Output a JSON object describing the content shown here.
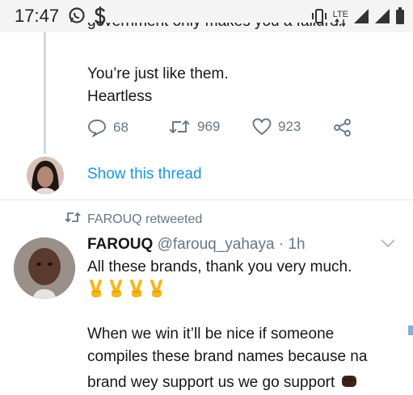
{
  "status_bar": {
    "time": "17:47",
    "left_icons": [
      "whatsapp-icon",
      "dollar-icon"
    ],
    "right_icons": [
      "vibrate-icon",
      "lte-icon",
      "signal-icon",
      "signal-icon",
      "battery-icon"
    ],
    "lte_label": "LTE"
  },
  "tweet1": {
    "clipped_text": "government only makes you a failure.",
    "line1": "You’re just like them.",
    "line2": "Heartless",
    "replies": "68",
    "retweets": "969",
    "likes": "923"
  },
  "show_thread": "Show this thread",
  "retweet_context": "FAROUQ retweeted",
  "tweet2": {
    "name": "FAROUQ",
    "handle": "@farouq_yahaya",
    "sep": "·",
    "time": "1h",
    "line1": "All these brands, thank you very much.",
    "emoji_count": 4,
    "line2": "When we win it’ll be nice if someone",
    "line3": "compiles these brand names because na",
    "line4": "brand wey support us we go support"
  },
  "colors": {
    "accent": "#1b95e0",
    "muted": "#657786",
    "text": "#14171a",
    "status_bg": "#f4f4f4"
  }
}
